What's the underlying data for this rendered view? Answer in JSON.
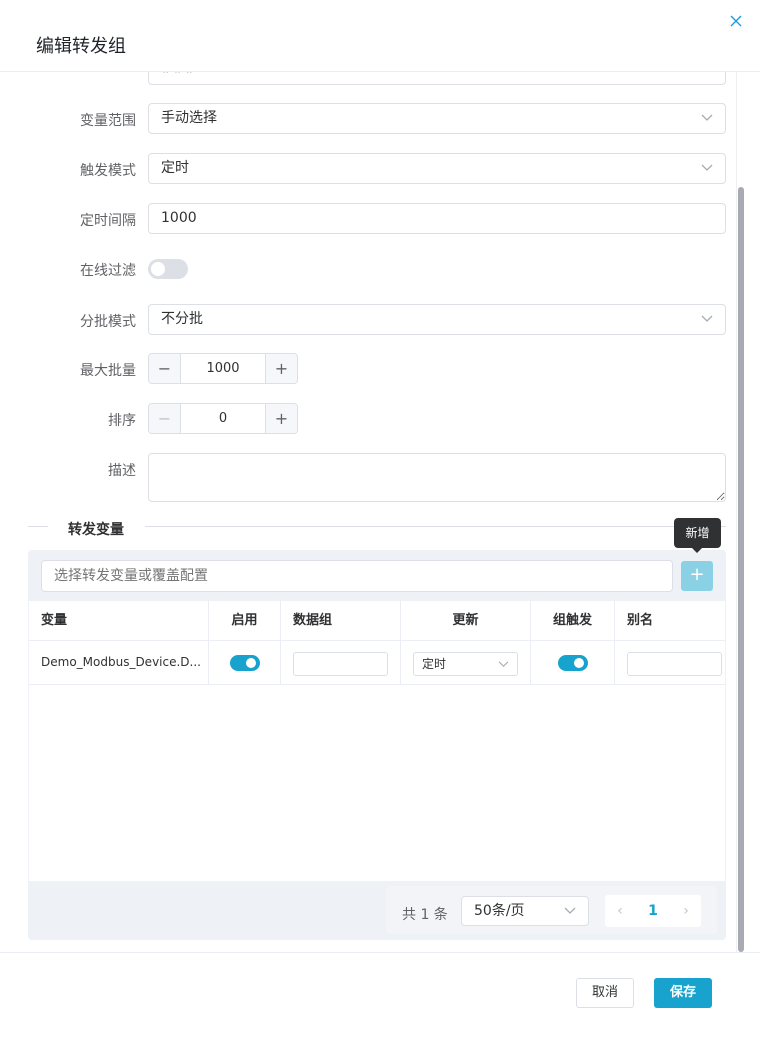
{
  "dialog": {
    "title": "编辑转发组"
  },
  "form": {
    "partial_value": "###",
    "var_scope": {
      "label": "变量范围",
      "value": "手动选择"
    },
    "trigger_mode": {
      "label": "触发模式",
      "value": "定时"
    },
    "interval": {
      "label": "定时间隔",
      "value": "1000"
    },
    "online_filter": {
      "label": "在线过滤",
      "on": false
    },
    "batch_mode": {
      "label": "分批模式",
      "value": "不分批"
    },
    "max_batch": {
      "label": "最大批量",
      "value": "1000",
      "minus": "−",
      "plus": "+"
    },
    "order": {
      "label": "排序",
      "value": "0",
      "minus": "−",
      "plus": "+"
    },
    "description": {
      "label": "描述",
      "value": ""
    }
  },
  "section": {
    "title": "转发变量"
  },
  "tooltip": {
    "text": "新增"
  },
  "search": {
    "placeholder": "选择转发变量或覆盖配置",
    "add": "+"
  },
  "table": {
    "headers": [
      "变量",
      "启用",
      "数据组",
      "更新",
      "组触发",
      "别名"
    ],
    "rows": [
      {
        "variable": "Demo_Modbus_Device.D...",
        "enabled": true,
        "data_group": "",
        "update": "定时",
        "group_trigger": true,
        "alias": ""
      }
    ]
  },
  "pager": {
    "total": "共 1 条",
    "page_size": "50条/页",
    "current": "1",
    "prev": "‹",
    "next": "›"
  },
  "footer": {
    "cancel": "取消",
    "save": "保存"
  },
  "colors": {
    "accent": "#17a3cd",
    "close": "#1a9ddb"
  }
}
